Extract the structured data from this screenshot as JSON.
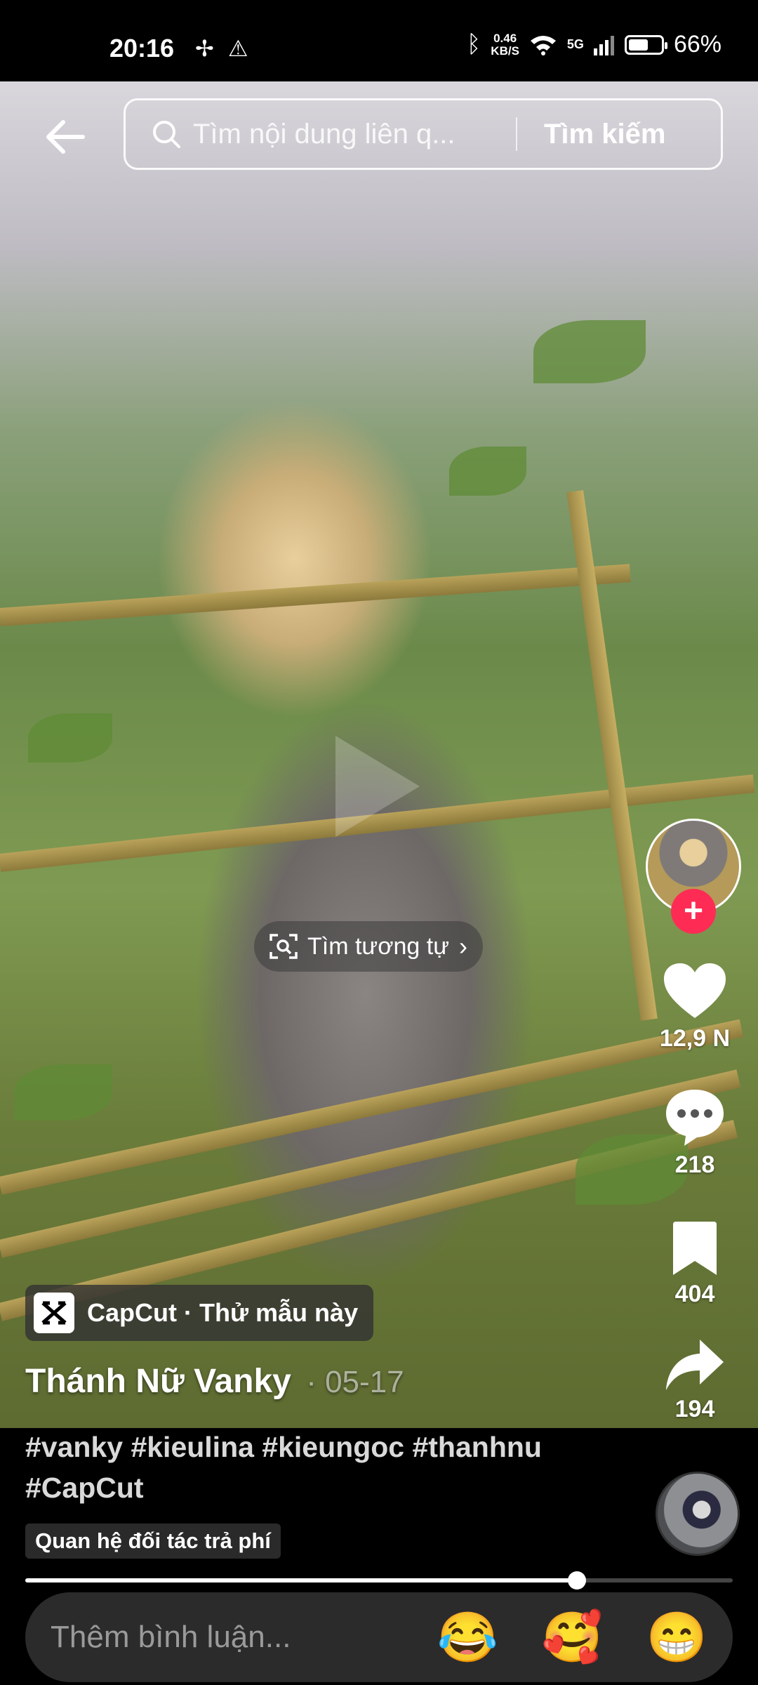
{
  "status_bar": {
    "time": "20:16",
    "speed_value": "0.46",
    "speed_unit": "KB/S",
    "network": "5G",
    "battery_percent": "66%",
    "battery_level": 0.66
  },
  "search": {
    "placeholder": "Tìm nội dung liên q...",
    "button_label": "Tìm kiếm"
  },
  "video": {
    "similar_label": "Tìm tương tự",
    "capcut_label": "CapCut · Thử mẫu này",
    "author": "Thánh Nữ Vanky",
    "date": "· 05-17",
    "caption": "#vanky #kieulina #kieungoc #thanhnu #CapCut",
    "partner_badge": "Quan hệ đối tác trả phí",
    "progress": 0.78
  },
  "actions": {
    "likes": "12,9 N",
    "comments": "218",
    "saves": "404",
    "shares": "194"
  },
  "comment": {
    "placeholder": "Thêm bình luận...",
    "emojis": [
      "😂",
      "🥰",
      "😁"
    ]
  },
  "colors": {
    "accent": "#fe2c55",
    "background": "#000000"
  }
}
